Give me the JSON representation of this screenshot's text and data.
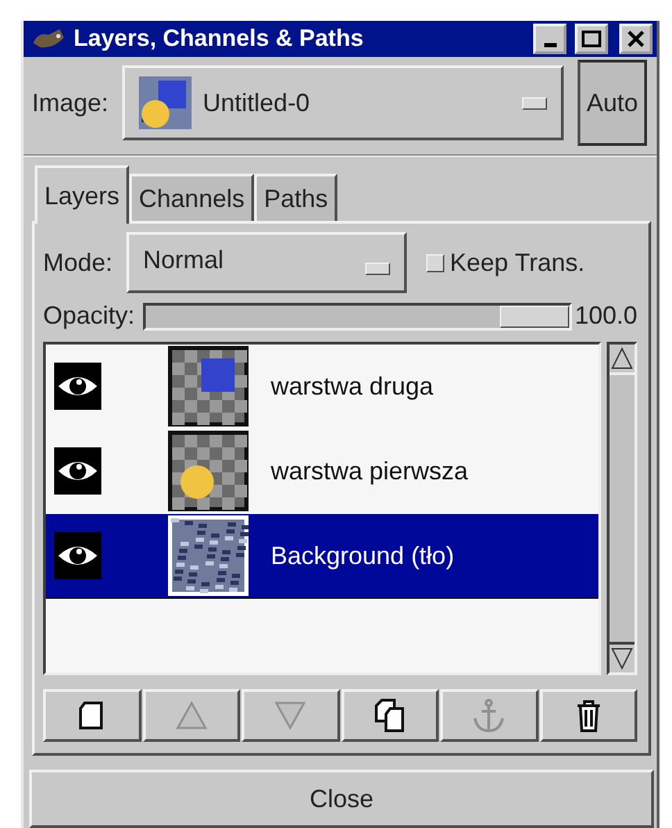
{
  "window": {
    "title": "Layers, Channels & Paths"
  },
  "image": {
    "label": "Image:",
    "value": "Untitled-0",
    "auto_button": "Auto"
  },
  "tabs": [
    {
      "label": "Layers",
      "selected": true
    },
    {
      "label": "Channels",
      "selected": false
    },
    {
      "label": "Paths",
      "selected": false
    }
  ],
  "mode": {
    "label": "Mode:",
    "value": "Normal"
  },
  "keep_trans": {
    "label": "Keep Trans.",
    "checked": false
  },
  "opacity": {
    "label": "Opacity:",
    "level": 1.0,
    "reading": "100.0"
  },
  "layers": [
    {
      "name": "warstwa druga",
      "visible": true,
      "selected": false,
      "kind": "square"
    },
    {
      "name": "warstwa pierwsza",
      "visible": true,
      "selected": false,
      "kind": "circle"
    },
    {
      "name": "Background (tło)",
      "visible": true,
      "selected": true,
      "kind": "noise"
    }
  ],
  "buttons": [
    {
      "kind": "new",
      "disabled": false
    },
    {
      "kind": "raise",
      "disabled": true
    },
    {
      "kind": "lower",
      "disabled": true
    },
    {
      "kind": "duplicate",
      "disabled": false
    },
    {
      "kind": "anchor",
      "disabled": true
    },
    {
      "kind": "delete",
      "disabled": false
    }
  ],
  "close_button": "Close"
}
